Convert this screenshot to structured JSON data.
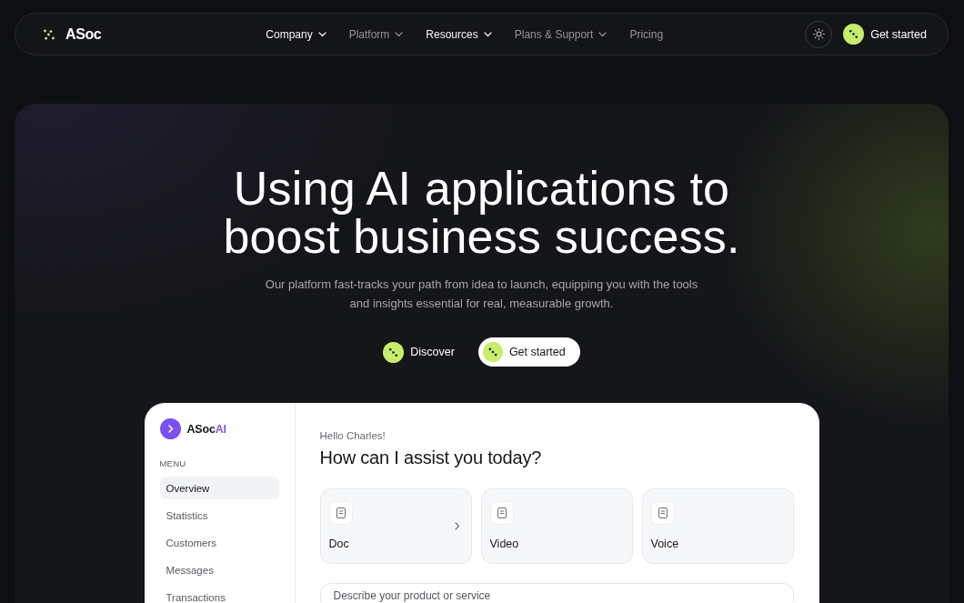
{
  "nav": {
    "logo": "ASoc",
    "links": [
      {
        "label": "Company",
        "highlighted": true,
        "dropdown": true
      },
      {
        "label": "Platform",
        "highlighted": false,
        "dropdown": true
      },
      {
        "label": "Resources",
        "highlighted": true,
        "dropdown": true
      },
      {
        "label": "Plans & Support",
        "highlighted": false,
        "dropdown": true
      },
      {
        "label": "Pricing",
        "highlighted": false,
        "dropdown": false
      }
    ],
    "cta": "Get started"
  },
  "hero": {
    "title_lines": [
      "Using AI applications to",
      "boost business success."
    ],
    "subtitle_lines": [
      "Our platform fast-tracks your path from idea to launch, equipping you with the tools",
      "and insights essential for real, measurable growth."
    ],
    "buttons": [
      {
        "label": "Discover",
        "kind": "plain"
      },
      {
        "label": "Get started",
        "kind": "pill"
      }
    ]
  },
  "app": {
    "brand": "ASoc",
    "brand_accent": "AI",
    "menu_heading": "MENU",
    "menu": [
      {
        "label": "Overview",
        "selected": true
      },
      {
        "label": "Statistics",
        "selected": false
      },
      {
        "label": "Customers",
        "selected": false
      },
      {
        "label": "Messages",
        "selected": false
      },
      {
        "label": "Transactions",
        "selected": false
      }
    ],
    "greeting": "Hello Charles!",
    "question": "How can I assist you today?",
    "options": [
      {
        "label": "Doc",
        "show_arrow": true
      },
      {
        "label": "Video",
        "show_arrow": false
      },
      {
        "label": "Voice",
        "show_arrow": false
      }
    ],
    "prompt": {
      "placeholder": "Describe your product or service"
    }
  }
}
